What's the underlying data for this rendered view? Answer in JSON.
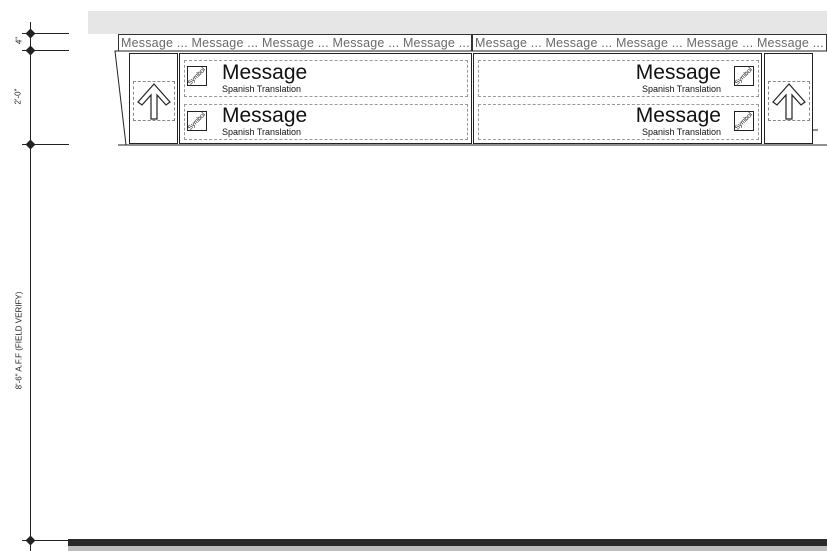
{
  "dimensions": {
    "top_gap": "4\"",
    "sign_height": "2'-0\"",
    "mount_height": "8'-6\" A.F.F (FIELD VERIFY)"
  },
  "strip_left": "Message ... Message ... Message ... Message ... Message ...",
  "strip_right": "Message ... Message ... Message ... Message ... Message ...",
  "left_panel": {
    "rows": [
      {
        "symbol": "Symbol",
        "message": "Message",
        "translation": "Spanish Translation"
      },
      {
        "symbol": "Symbol",
        "message": "Message",
        "translation": "Spanish Translation"
      }
    ]
  },
  "right_panel": {
    "rows": [
      {
        "symbol": "Symbol",
        "message": "Message",
        "translation": "Spanish Translation"
      },
      {
        "symbol": "Symbol",
        "message": "Message",
        "translation": "Spanish Translation"
      }
    ]
  },
  "arrows": [
    "arrow-up-icon",
    "arrow-up-icon"
  ]
}
